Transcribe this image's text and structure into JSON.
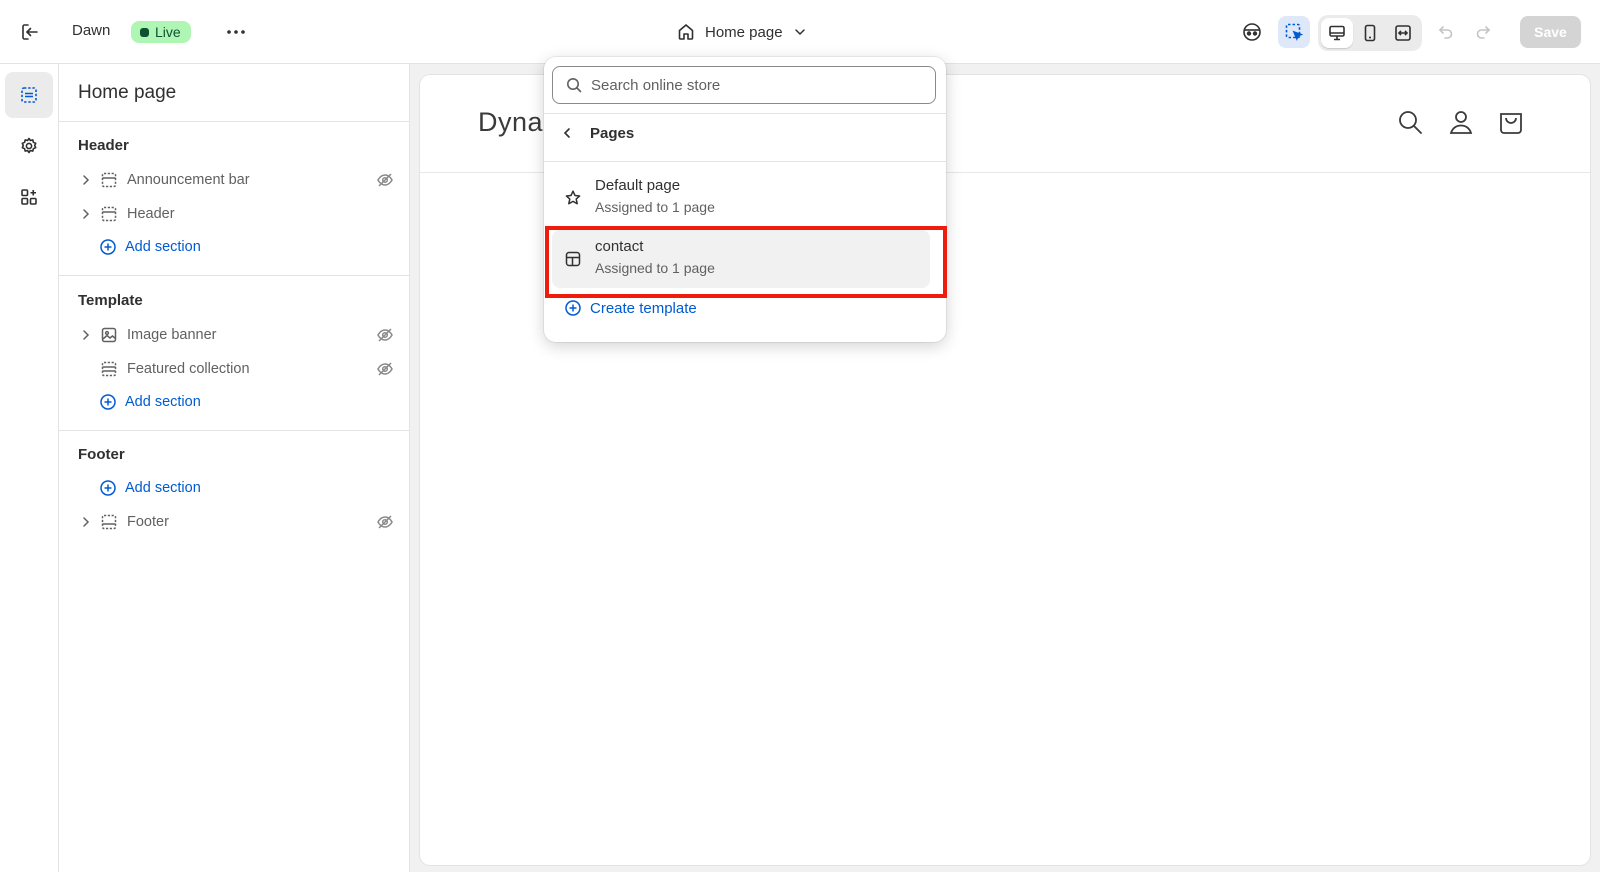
{
  "topbar": {
    "theme_name": "Dawn",
    "status_badge": "Live",
    "current_page": "Home page",
    "save_label": "Save",
    "icons": [
      "exit-icon",
      "more-icon",
      "home-icon",
      "chevron-down-icon",
      "eyes-icon",
      "inspector-icon",
      "desktop-icon",
      "mobile-icon",
      "fullwidth-icon",
      "undo-icon",
      "redo-icon"
    ]
  },
  "rail": {
    "items": [
      "sections-icon",
      "settings-icon",
      "apps-icon"
    ]
  },
  "sidebar": {
    "title": "Home page",
    "groups": [
      {
        "title": "Header",
        "sections": [
          {
            "label": "Announcement bar",
            "hidden": true
          },
          {
            "label": "Header",
            "hidden": false
          }
        ],
        "add_label": "Add section"
      },
      {
        "title": "Template",
        "sections": [
          {
            "label": "Image banner",
            "hidden": true
          },
          {
            "label": "Featured collection",
            "hidden": true
          }
        ],
        "add_label": "Add section"
      },
      {
        "title": "Footer",
        "sections": [
          {
            "label": "Footer",
            "hidden": true
          }
        ],
        "add_label": "Add section"
      }
    ]
  },
  "preview": {
    "store_name": "Dynar"
  },
  "dropdown": {
    "search_placeholder": "Search online store",
    "back_label": "Pages",
    "templates": [
      {
        "name": "Default page",
        "subtitle": "Assigned to 1 page",
        "selected": false
      },
      {
        "name": "contact",
        "subtitle": "Assigned to 1 page",
        "selected": true
      }
    ],
    "create_label": "Create template"
  },
  "colors": {
    "accent": "#005bd3",
    "live_badge_bg": "#aff5b4",
    "live_badge_text": "#0c5132",
    "highlight": "#ee1c0c"
  }
}
